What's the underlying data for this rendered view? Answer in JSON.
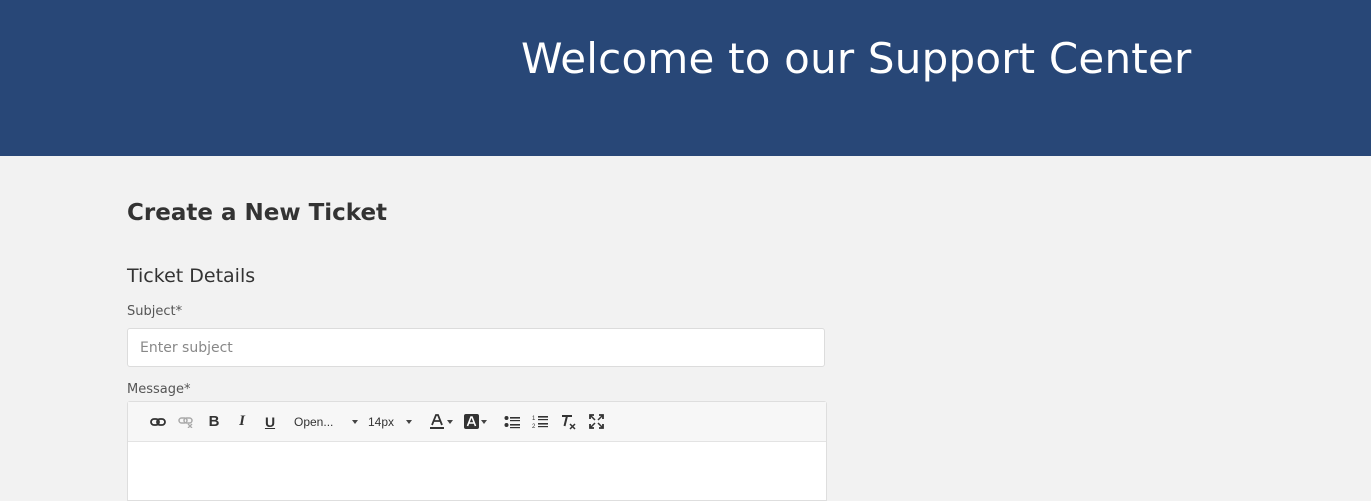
{
  "header": {
    "title": "Welcome to our Support Center"
  },
  "page": {
    "title": "Create a New Ticket",
    "section_title": "Ticket Details"
  },
  "form": {
    "subject_label": "Subject*",
    "subject_placeholder": "Enter subject",
    "subject_value": "",
    "message_label": "Message*"
  },
  "toolbar": {
    "bold": "B",
    "italic": "I",
    "underline": "U",
    "font_family": "Open...",
    "font_size": "14px",
    "icons": [
      "link-icon",
      "unlink-icon",
      "bold-icon",
      "italic-icon",
      "underline-icon",
      "font-color-icon",
      "background-color-icon",
      "bullet-list-icon",
      "numbered-list-icon",
      "clear-format-icon",
      "fullscreen-icon"
    ]
  },
  "colors": {
    "header_bg": "#284777",
    "page_bg": "#f2f2f2",
    "text": "#333333"
  }
}
